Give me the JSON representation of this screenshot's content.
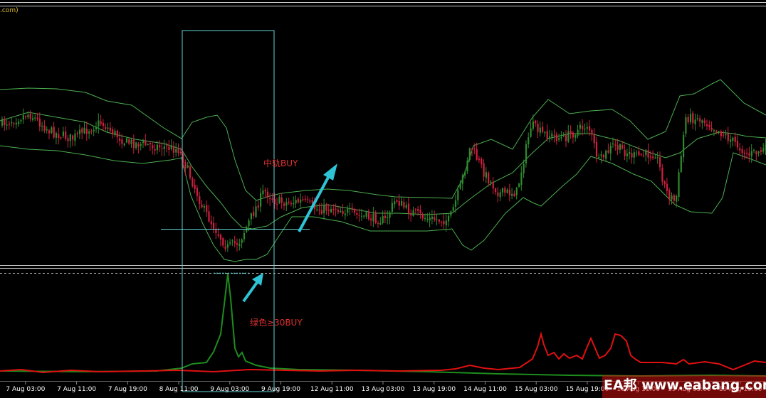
{
  "window": {
    "title_fragment": ".com)"
  },
  "annotations": {
    "mid_band_buy": "中轨BUY",
    "green_line_buy": "绿色≥30BUY"
  },
  "watermark": {
    "text": "EA邦 www.eabang.com"
  },
  "time_axis": {
    "labels": [
      "7 Aug 03:00",
      "7 Aug 11:00",
      "7 Aug 19:00",
      "8 Aug 11:00",
      "9 Aug 03:00",
      "9 Aug 19:00",
      "12 Aug 11:00",
      "13 Aug 03:00",
      "13 Aug 19:00",
      "14 Aug 11:00",
      "15 Aug 03:00",
      "15 Aug 19:00",
      "16 Aug 11:00",
      "19 Aug 03:00",
      "19 Aug 19:00"
    ]
  },
  "colors": {
    "background": "#000000",
    "band": "#4CAF50",
    "candle_up": "#2E8B2E",
    "candle_down": "#D02040",
    "highlight_box": "#5FD3D3",
    "arrow": "#2EC4D6",
    "annotation": "#E03030",
    "indicator_green": "#1E8C1E",
    "indicator_red": "#E01010",
    "title": "#E0C030",
    "axis_text": "#FFFFFF",
    "watermark": "#FFFFFF",
    "watermark_bg": "#D01010"
  }
}
